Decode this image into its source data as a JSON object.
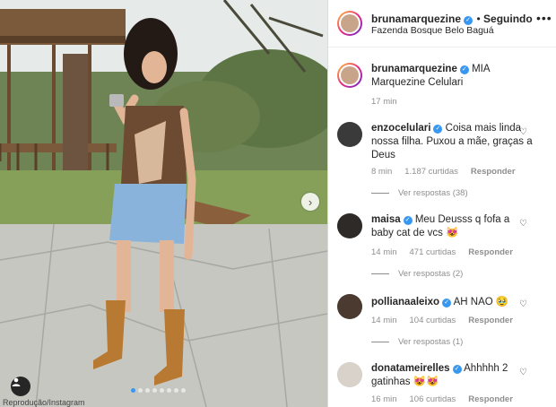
{
  "post": {
    "author": "brunamarquezine",
    "following_label": "Seguindo",
    "location": "Fazenda Bosque Belo Baguá",
    "caption_text": "MIA Marquezine Celulari",
    "caption_time": "17 min",
    "carousel_dots": 8,
    "active_dot": 0,
    "image_overlay_text": "Reprodução/Instagram"
  },
  "comments": [
    {
      "username": "enzocelulari",
      "verified": true,
      "text": "Coisa mais linda nossa filha. Puxou a mãe, graças a Deus",
      "time": "8 min",
      "likes": "1.187 curtidas",
      "reply_label": "Responder",
      "view_replies": "Ver respostas (38)"
    },
    {
      "username": "maisa",
      "verified": true,
      "text": "Meu Deusss q fofa a baby cat de vcs 😻",
      "time": "14 min",
      "likes": "471 curtidas",
      "reply_label": "Responder",
      "view_replies": "Ver respostas (2)"
    },
    {
      "username": "pollianaaleixo",
      "verified": true,
      "text": "AH NAO 🥹",
      "time": "14 min",
      "likes": "104 curtidas",
      "reply_label": "Responder",
      "view_replies": "Ver respostas (1)"
    },
    {
      "username": "donatameirelles",
      "verified": true,
      "text": "Ahhhhh 2 gatinhas 😻😻",
      "time": "16 min",
      "likes": "106 curtidas",
      "reply_label": "Responder"
    }
  ],
  "colors": {
    "verified": "#3897f0",
    "muted": "#8e8e8e"
  },
  "icons": {
    "more": "more-horizontal-icon",
    "heart": "heart-outline-icon",
    "next": "chevron-right-icon",
    "user": "user-tag-icon"
  }
}
